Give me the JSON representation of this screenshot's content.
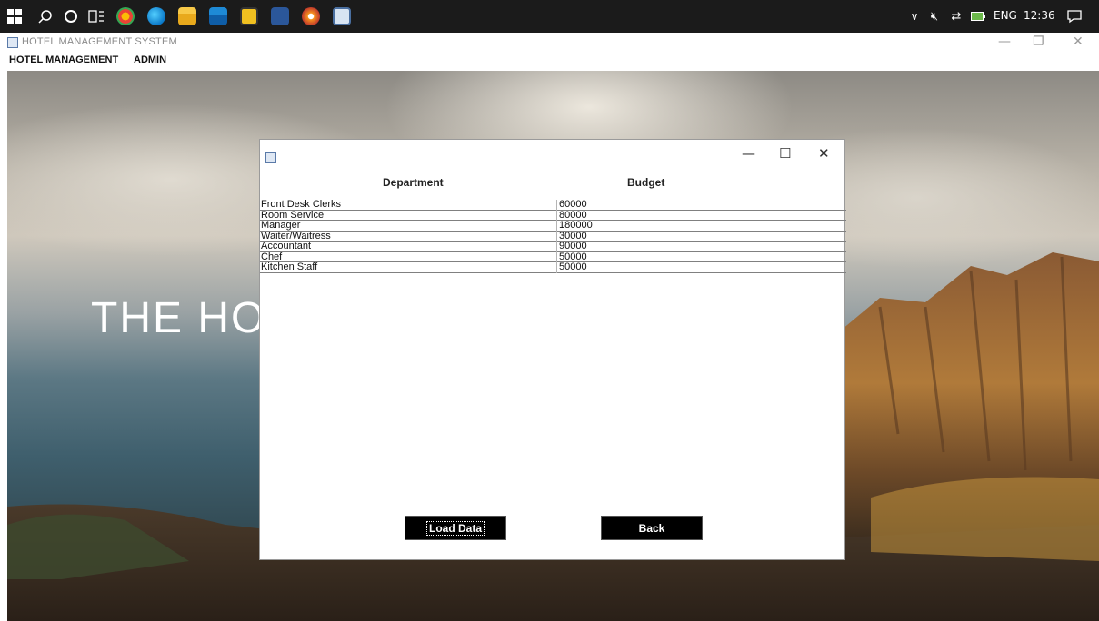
{
  "taskbar": {
    "tray": {
      "language": "ENG",
      "time": "12:36"
    }
  },
  "main_window": {
    "title": "HOTEL MANAGEMENT SYSTEM",
    "menus": [
      "HOTEL MANAGEMENT",
      "ADMIN"
    ]
  },
  "background": {
    "heading_partial": "THE HO"
  },
  "dialog": {
    "columns": [
      "Department",
      "Budget"
    ],
    "rows": [
      [
        "Front Desk Clerks",
        "60000"
      ],
      [
        "Room Service",
        "80000"
      ],
      [
        "Manager",
        "180000"
      ],
      [
        "Waiter/Waitress",
        "30000"
      ],
      [
        "Accountant",
        "90000"
      ],
      [
        "Chef",
        "50000"
      ],
      [
        "Kitchen Staff",
        "50000"
      ]
    ],
    "buttons": {
      "load": "Load Data",
      "back": "Back"
    }
  },
  "icons": {
    "start": "windows-start-icon",
    "search": "search-icon",
    "cortana": "cortana-icon",
    "task_view": "task-view-icon"
  }
}
